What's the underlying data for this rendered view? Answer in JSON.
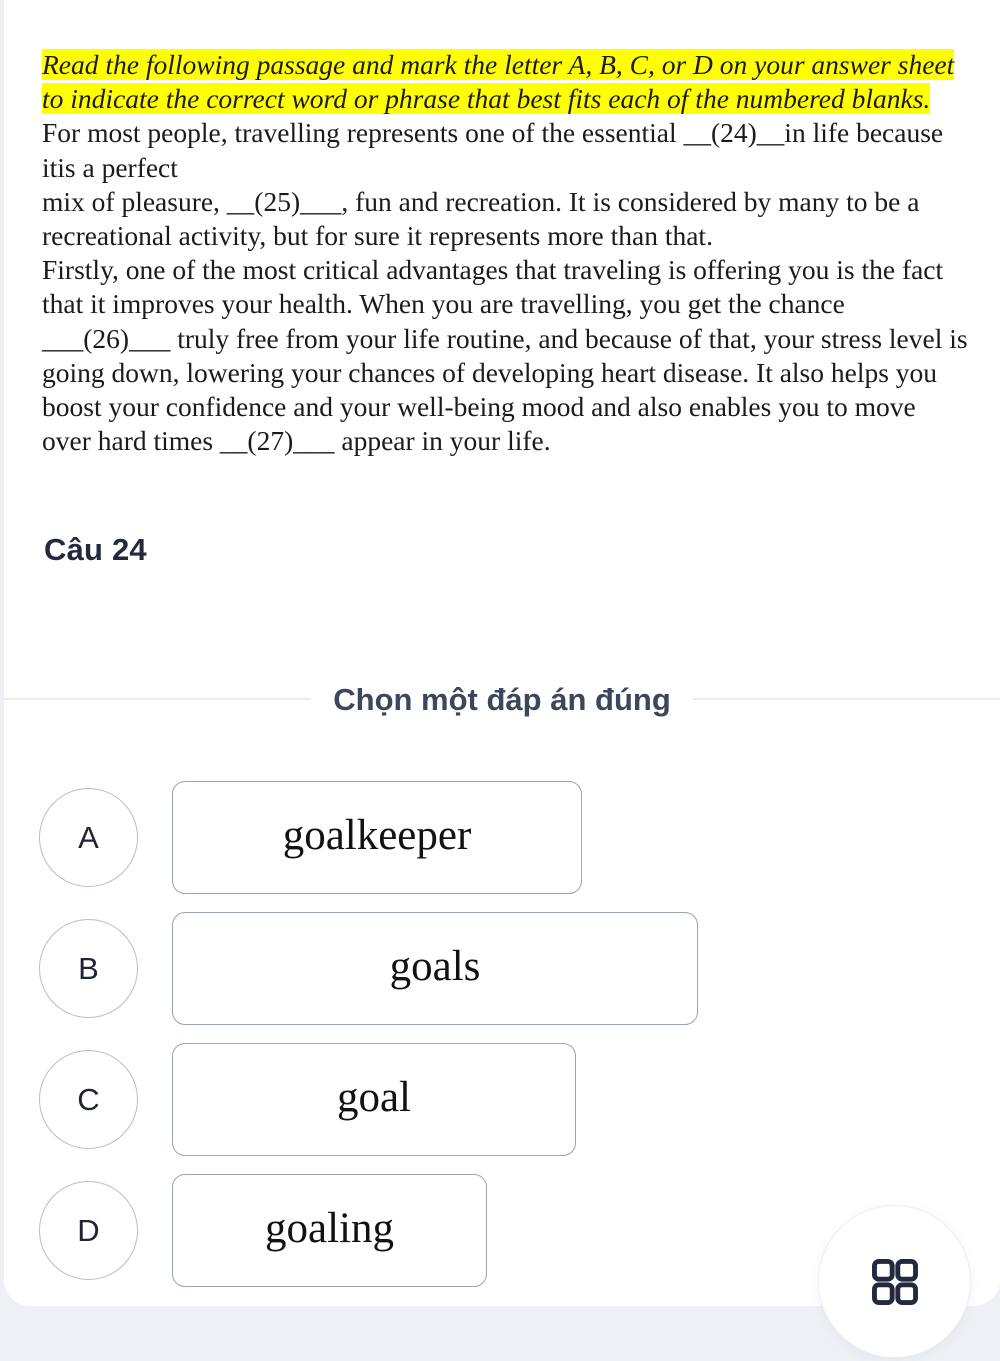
{
  "colors": {
    "page_background": "#eef0f6",
    "card_background": "#ffffff",
    "highlight": "#ffff00",
    "heading_text": "#242a3d",
    "divider_line": "#e9ecf3",
    "option_circle_border": "#b6bdcb",
    "option_box_border": "#9aa3b5",
    "icon": "#242a3d"
  },
  "passage": {
    "instruction": "Read the following passage and mark the letter A, B, C, or D on your answer sheet to indicate the correct word or phrase that best fits each of the numbered blanks.",
    "body": "For most people, travelling represents one of the essential __(24)__in life because itis a perfect\nmix of pleasure, __(25)___, fun and recreation. It is considered by many to be a recreational activity, but for sure it represents more than that.\nFirstly, one of the most critical advantages that traveling is offering you is the fact that it improves your health. When you are travelling, you get the chance ___(26)___ truly free from your life routine, and because of that, your stress level is going down, lowering your chances of developing heart disease. It also helps you boost your confidence and your well-being mood and also enables you to move over hard times __(27)___ appear in your life."
  },
  "question": {
    "title": "Câu 24"
  },
  "divider": {
    "label": "Chọn một đáp án đúng"
  },
  "options": [
    {
      "letter": "A",
      "text": "goalkeeper"
    },
    {
      "letter": "B",
      "text": "goals"
    },
    {
      "letter": "C",
      "text": "goal"
    },
    {
      "letter": "D",
      "text": "goaling"
    }
  ],
  "fab": {
    "icon": "grid-2x2-icon"
  }
}
